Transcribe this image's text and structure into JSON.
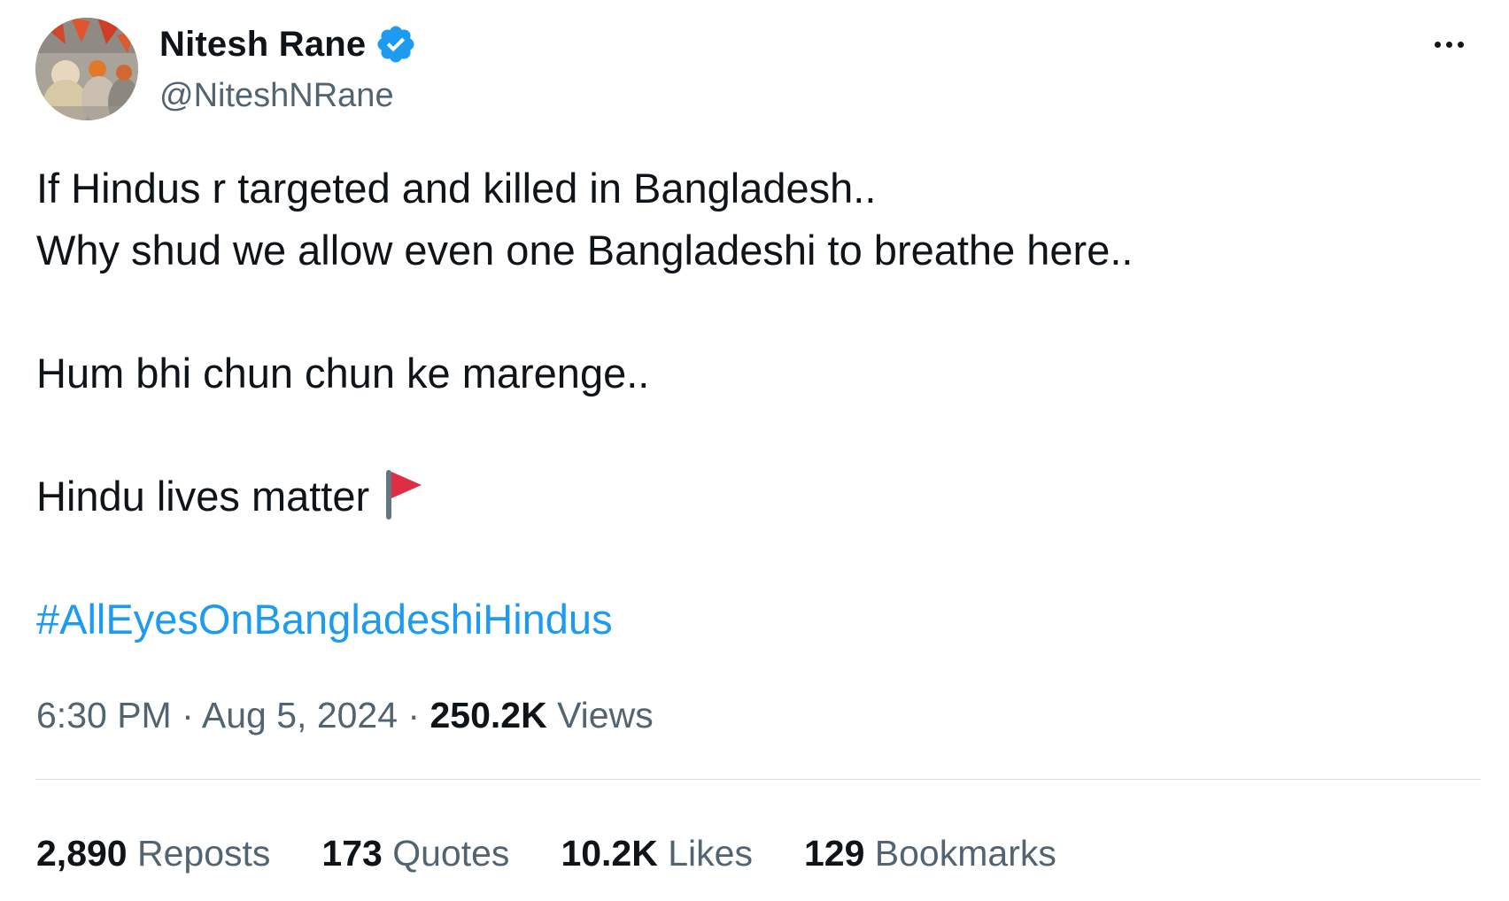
{
  "author": {
    "display_name": "Nitesh Rane",
    "handle": "@NiteshNRane",
    "verified": true,
    "avatar_icon": "avatar-photo"
  },
  "icons": {
    "verified": "verified-badge-icon",
    "more": "more-options-icon",
    "flag": "red-flag-emoji-icon"
  },
  "colors": {
    "accent": "#1d9bf0",
    "text": "#0f1419",
    "muted": "#536471",
    "divider": "#d9dde1"
  },
  "tweet": {
    "line1": "If Hindus r targeted and killed in Bangladesh..",
    "line2": "Why shud we allow even one Bangladeshi to breathe here..",
    "line3": "Hum bhi chun chun ke marenge..",
    "line4": "Hindu lives matter",
    "hashtag": "#AllEyesOnBangladeshiHindus"
  },
  "meta": {
    "time": "6:30 PM",
    "sep1": " · ",
    "date": "Aug 5, 2024",
    "sep2": " · ",
    "views_count": "250.2K",
    "views_label": " Views"
  },
  "stats": {
    "reposts_count": "2,890",
    "reposts_label": " Reposts",
    "quotes_count": "173",
    "quotes_label": " Quotes",
    "likes_count": "10.2K",
    "likes_label": " Likes",
    "bookmarks_count": "129",
    "bookmarks_label": " Bookmarks"
  }
}
